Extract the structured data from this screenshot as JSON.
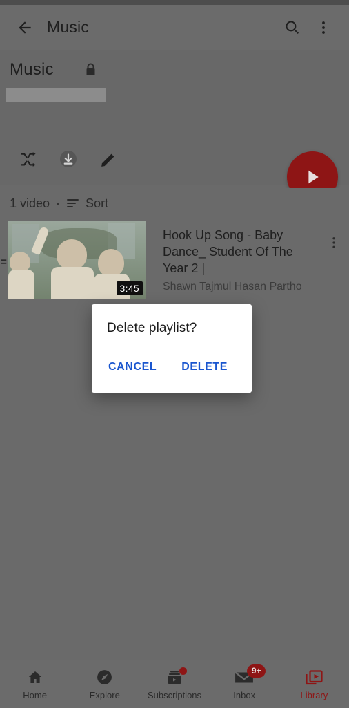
{
  "appbar": {
    "back_icon": "arrow-back-icon",
    "title": "Music",
    "search_icon": "search-icon",
    "more_icon": "more-vert-icon"
  },
  "playlist_header": {
    "title": "Music",
    "privacy_icon": "lock-icon"
  },
  "actions": {
    "shuffle_icon": "shuffle-icon",
    "download_icon": "download-circle-icon",
    "edit_icon": "pencil-edit-icon",
    "play_fab_icon": "play-icon",
    "fab_color": "#8e1515"
  },
  "meta": {
    "count": "1 video",
    "separator": "·",
    "sort_icon": "sort-icon",
    "sort_label": "Sort"
  },
  "video": {
    "title": "Hook Up Song - Baby Dance_ Student Of The Year 2 |",
    "channel": "Shawn Tajmul Hasan Partho",
    "duration": "3:45",
    "drag_handle_icon": "drag-handle-icon",
    "menu_icon": "more-vert-icon"
  },
  "dialog": {
    "title": "Delete playlist?",
    "cancel_label": "CANCEL",
    "delete_label": "DELETE",
    "button_color": "#1a56cf"
  },
  "bottom_nav": {
    "items": [
      {
        "label": "Home",
        "icon": "home-icon",
        "badge": "",
        "active": false
      },
      {
        "label": "Explore",
        "icon": "compass-explore-icon",
        "badge": "",
        "active": false
      },
      {
        "label": "Subscriptions",
        "icon": "subscriptions-icon",
        "badge": "dot",
        "active": false
      },
      {
        "label": "Inbox",
        "icon": "inbox-envelope-icon",
        "badge": "9+",
        "active": false
      },
      {
        "label": "Library",
        "icon": "library-icon",
        "badge": "",
        "active": true
      }
    ],
    "active_color": "#8e1515"
  }
}
